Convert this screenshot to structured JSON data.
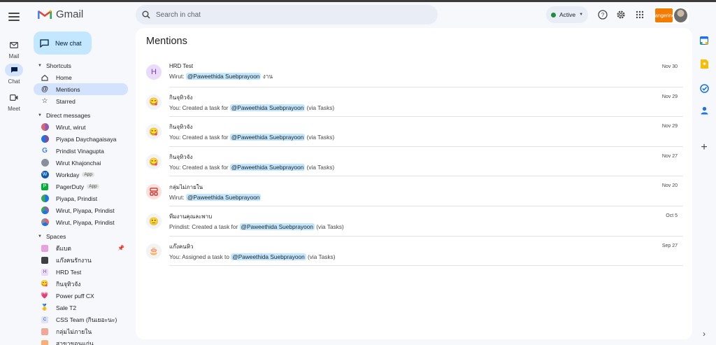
{
  "app": {
    "logo_text": "Gmail"
  },
  "rail": {
    "items": [
      {
        "label": "Mail",
        "icon": "mail-icon"
      },
      {
        "label": "Chat",
        "icon": "chat-icon"
      },
      {
        "label": "Meet",
        "icon": "video-icon"
      }
    ]
  },
  "new_chat_label": "New chat",
  "search": {
    "placeholder": "Search in chat"
  },
  "status": {
    "label": "Active"
  },
  "brand": {
    "text": "tangerine"
  },
  "sidebar": {
    "shortcuts_header": "Shortcuts",
    "shortcuts": [
      {
        "label": "Home",
        "icon": "home-icon"
      },
      {
        "label": "Mentions",
        "icon": "at-sign-icon"
      },
      {
        "label": "Starred",
        "icon": "star-icon"
      }
    ],
    "dm_header": "Direct messages",
    "dms": [
      {
        "label": "Wirut, wirut",
        "badge": ""
      },
      {
        "label": "Piyapa Daychagaisaya",
        "badge": ""
      },
      {
        "label": "Prindist Vinagupta",
        "badge": ""
      },
      {
        "label": "Wirut Khajonchai",
        "badge": ""
      },
      {
        "label": "Workday",
        "badge": "App"
      },
      {
        "label": "PagerDuty",
        "badge": "App"
      },
      {
        "label": "Piyapa, Prindist",
        "badge": ""
      },
      {
        "label": "Wirut, Piyapa, Prindist",
        "badge": ""
      },
      {
        "label": "Wirut, Piyapa, Prindist",
        "badge": ""
      }
    ],
    "spaces_header": "Spaces",
    "spaces": [
      {
        "label": "ดีแบต",
        "glyph": ""
      },
      {
        "label": "แก๊งคนรักงาน",
        "glyph": ""
      },
      {
        "label": "HRD Test",
        "glyph": "H"
      },
      {
        "label": "กินจุทิวจัง",
        "glyph": "😋"
      },
      {
        "label": "Power puff CX",
        "glyph": "💗"
      },
      {
        "label": "Sale T2",
        "glyph": "🥇"
      },
      {
        "label": "CSS Team (กินเยอะนะ)",
        "glyph": "C"
      },
      {
        "label": "กลุ่มไม่ภายใน",
        "glyph": ""
      },
      {
        "label": "สาขาขอนแก่น",
        "glyph": ""
      }
    ]
  },
  "main": {
    "title": "Mentions",
    "rows": [
      {
        "title": "HRD Test",
        "prefix": "Wirut: ",
        "mention": "@Paweethida Suebprayoon",
        "suffix": " งาน",
        "date": "Nov 30",
        "avatar": "H"
      },
      {
        "title": "กินจุทิวจัง",
        "prefix": "You: Created a task for ",
        "mention": "@Paweethida Suebprayoon",
        "suffix": " (via Tasks)",
        "date": "Nov 29",
        "avatar": "😋"
      },
      {
        "title": "กินจุทิวจัง",
        "prefix": "You: Created a task for ",
        "mention": "@Paweethida Suebprayoon",
        "suffix": " (via Tasks)",
        "date": "Nov 29",
        "avatar": "😋"
      },
      {
        "title": "กินจุทิวจัง",
        "prefix": "You: Created a task for ",
        "mention": "@Paweethida Suebprayoon",
        "suffix": " (via Tasks)",
        "date": "Nov 27",
        "avatar": "😋"
      },
      {
        "title": "กลุ่มไม่ภายใน",
        "prefix": "Wirut: ",
        "mention": "@Paweethida Suebprayoon",
        "suffix": "",
        "date": "Nov 20",
        "avatar": ""
      },
      {
        "title": "ทีมงานคุณละพาบ",
        "prefix": "Prindist: Created a task for ",
        "mention": "@Paweethida Suebprayoon",
        "suffix": " (via Tasks)",
        "date": "Oct 5",
        "avatar": "🙂"
      },
      {
        "title": "แก๊งคนหิว",
        "prefix": "You: Assigned a task to ",
        "mention": "@Paweethida Suebprayoon",
        "suffix": " (via Tasks)",
        "date": "Sep 27",
        "avatar": "🎂"
      }
    ]
  },
  "colors": {
    "accent": "#c2e7ff",
    "selected": "#d3e3fd",
    "brand": "#f27b00",
    "active_dot": "#1e8e3e"
  }
}
